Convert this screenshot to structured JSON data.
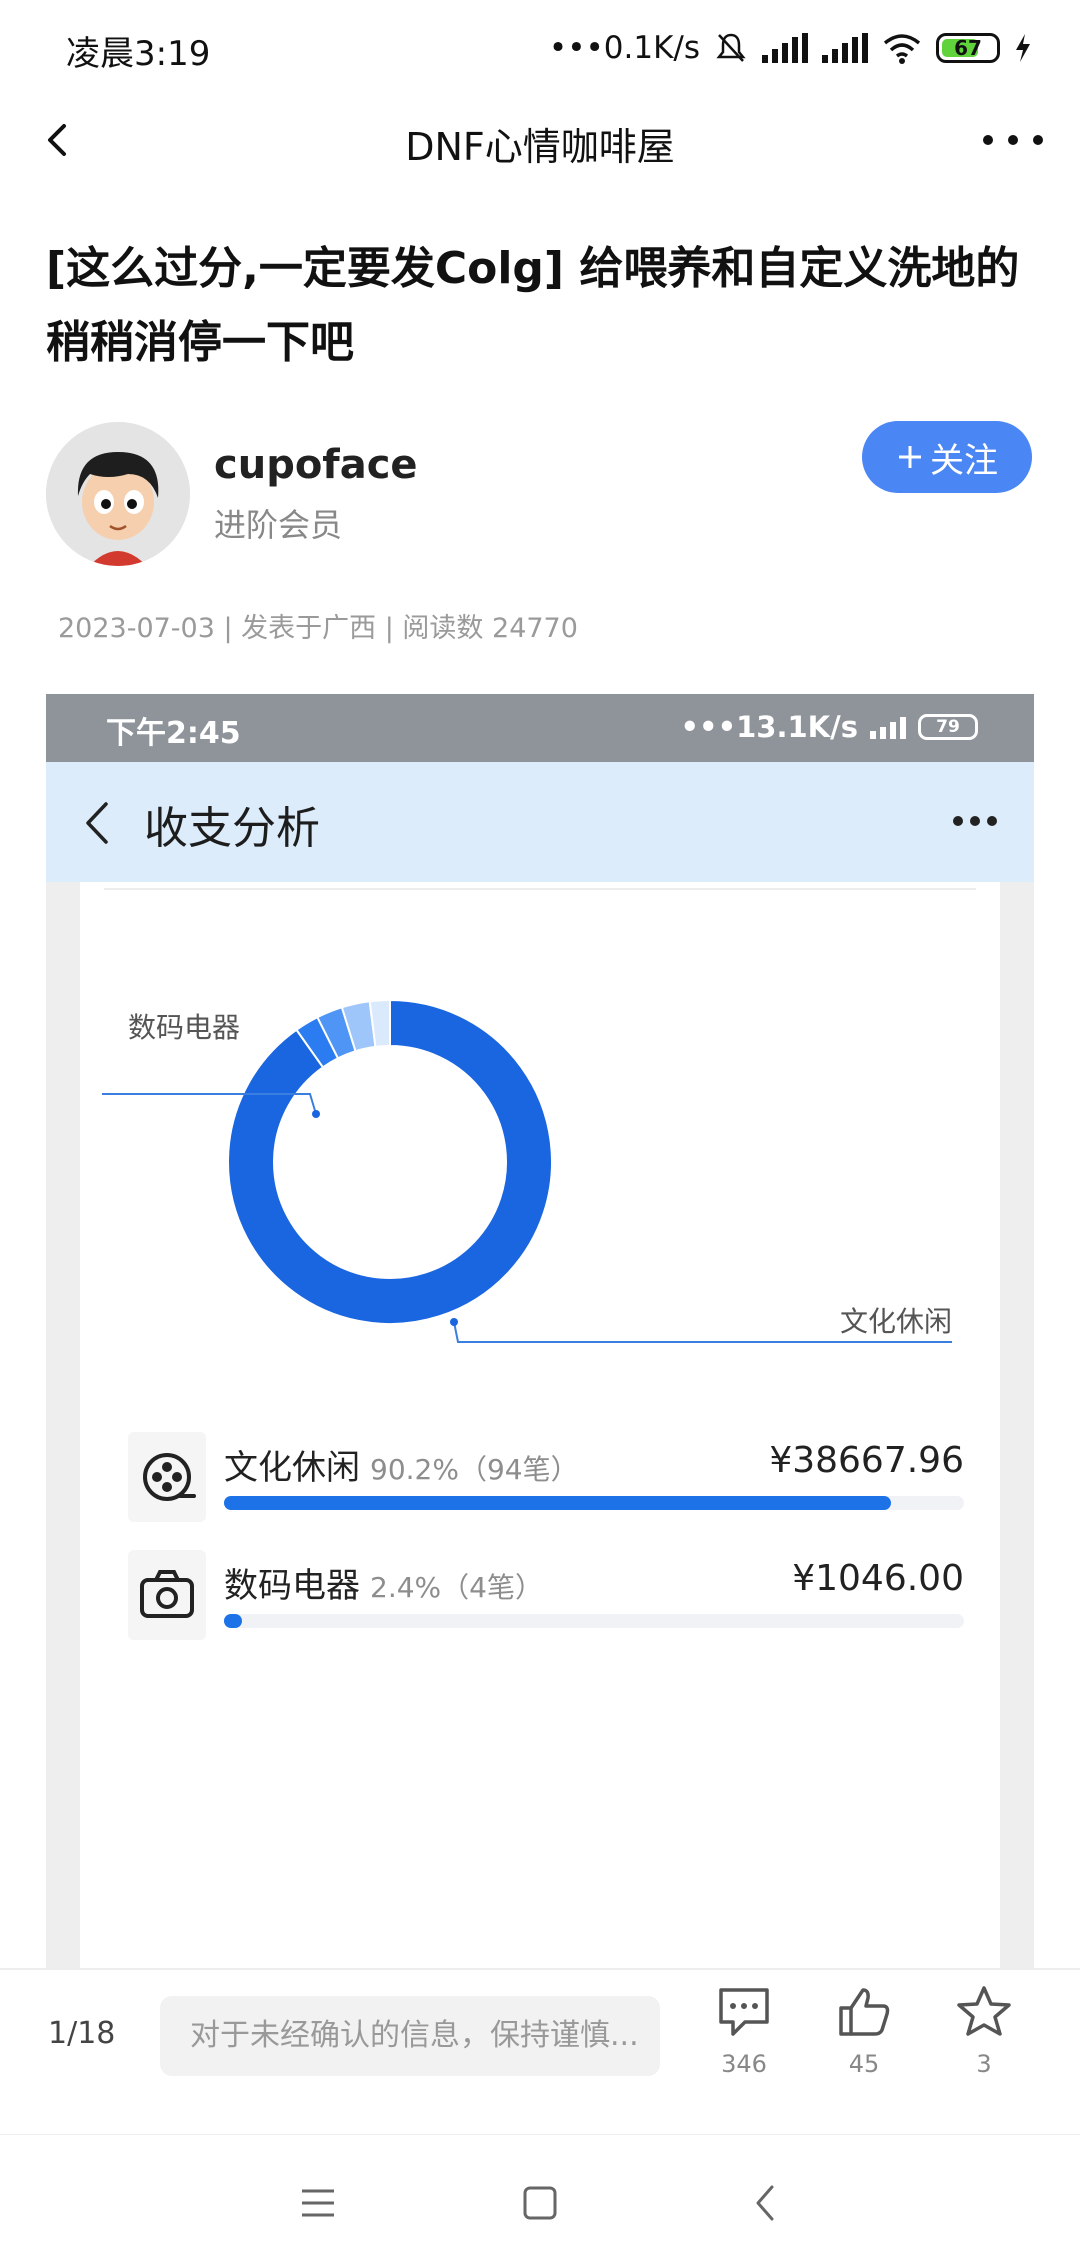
{
  "status_bar": {
    "time": "凌晨3:19",
    "net_speed": "0.1K/s",
    "battery": "67"
  },
  "titlebar": {
    "title": "DNF心情咖啡屋"
  },
  "post": {
    "headline": "[这么过分,一定要发Colg] 给喂养和自定义洗地的稍稍消停一下吧",
    "author": {
      "name": "cupoface",
      "level": "进阶会员",
      "follow_label": "关注"
    },
    "meta": "2023-07-03 | 发表于广西 | 阅读数 24770"
  },
  "embedded_screenshot": {
    "status_time": "下午2:45",
    "status_net": "13.1K/s",
    "status_battery": "79",
    "header_title": "收支分析",
    "callout_top": "数码电器",
    "callout_bottom": "文化休闲",
    "rows": [
      {
        "name": "文化休闲",
        "percent": "90.2%（94笔）",
        "amount": "¥38667.96",
        "share": 0.902
      },
      {
        "name": "数码电器",
        "percent": "2.4%（4笔）",
        "amount": "¥1046.00",
        "share": 0.024
      }
    ]
  },
  "chart_data": {
    "type": "pie",
    "variant": "donut",
    "categories": [
      "文化休闲",
      "数码电器",
      "",
      "",
      ""
    ],
    "values": [
      90.2,
      2.4,
      2.6,
      2.8,
      2.0
    ],
    "colors": [
      "#1a66e0",
      "#2b7cf0",
      "#4e95f5",
      "#9fc6fa",
      "#dbe9fd"
    ]
  },
  "action_bar": {
    "page_indicator": "1/18",
    "comment_placeholder": "对于未经确认的信息，保持谨慎...",
    "comments": "346",
    "likes": "45",
    "favorites": "3"
  },
  "icons": {
    "back": "back-arrow-icon",
    "more": "more-dots-icon",
    "comment": "comment-icon",
    "like": "thumbs-up-icon",
    "favorite": "star-icon",
    "film": "film-reel-icon",
    "camera": "camera-icon"
  }
}
